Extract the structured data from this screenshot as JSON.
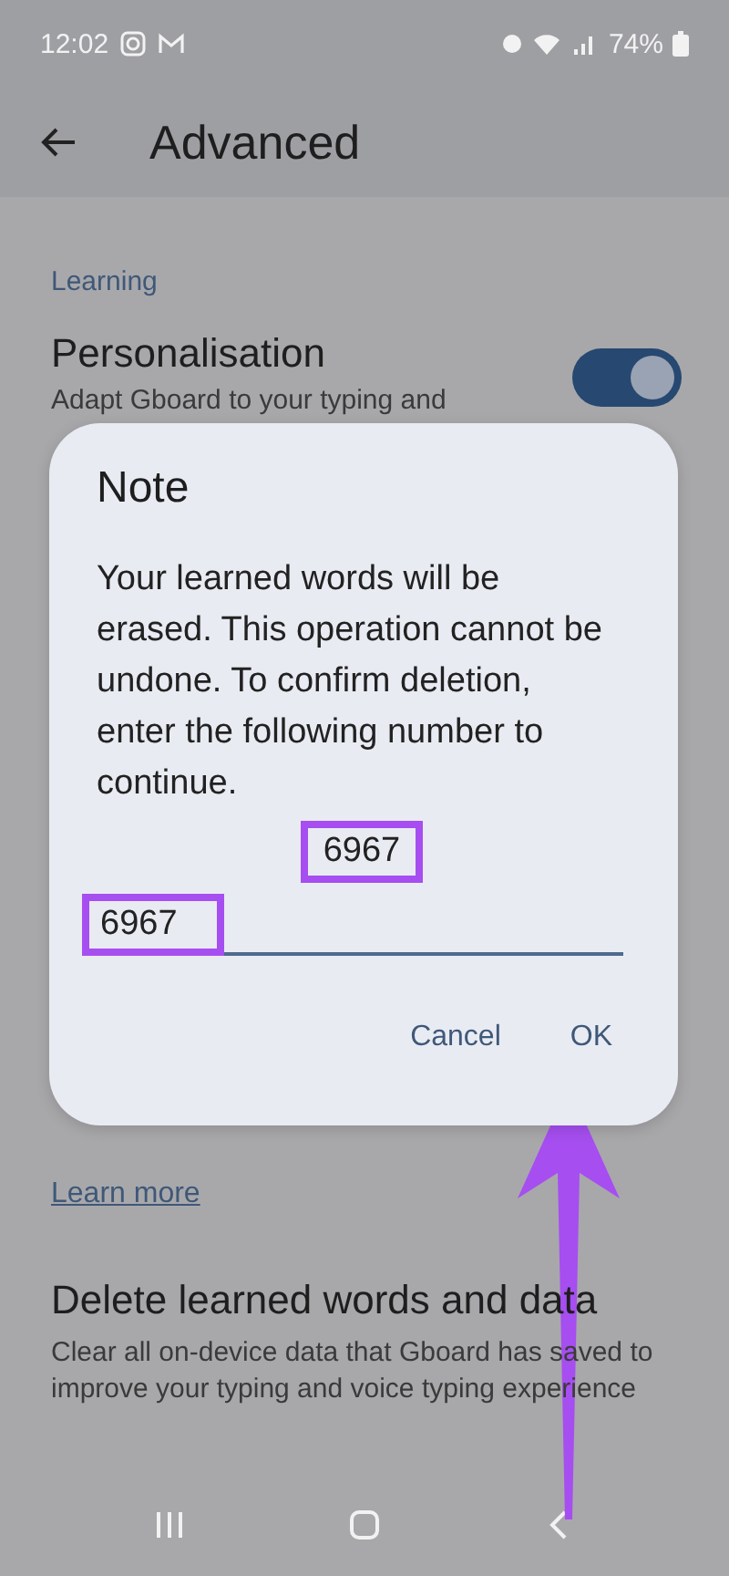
{
  "status_bar": {
    "time": "12:02",
    "battery": "74%"
  },
  "app_bar": {
    "title": "Advanced"
  },
  "section": {
    "heading": "Learning"
  },
  "settings": [
    {
      "title": "Personalisation",
      "subtitle": "Adapt Gboard to your typing and",
      "on": true
    }
  ],
  "learn_more": "Learn more",
  "delete_item": {
    "title": "Delete learned words and data",
    "subtitle": "Clear all on-device data that Gboard has saved to improve your typing and voice typing experience"
  },
  "dialog": {
    "title": "Note",
    "message": "Your learned words will be erased. This operation cannot be undone. To confirm deletion, enter the following number to continue.",
    "code": "6967",
    "input_value": "6967",
    "buttons": [
      {
        "label": "Cancel"
      },
      {
        "label": "OK"
      }
    ]
  }
}
